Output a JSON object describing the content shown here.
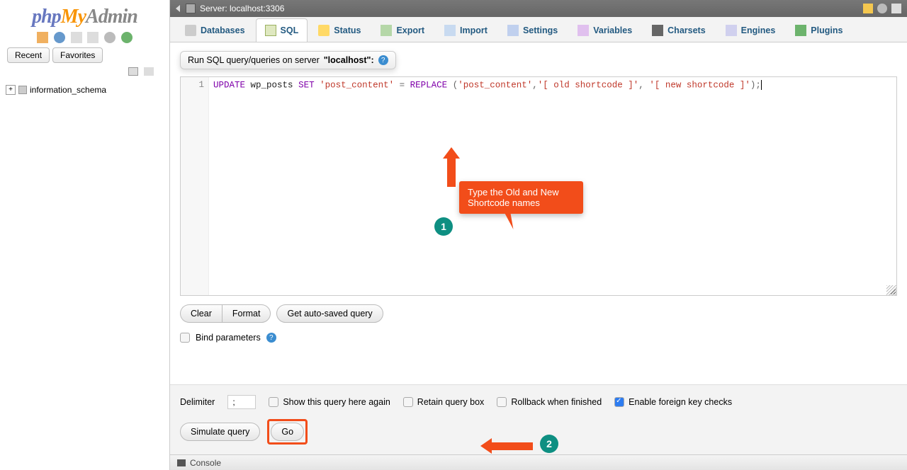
{
  "logo": {
    "p1": "php",
    "p2": "My",
    "p3": "Admin"
  },
  "sidebar": {
    "tabs": {
      "recent": "Recent",
      "favorites": "Favorites"
    },
    "tree": {
      "item1": "information_schema"
    }
  },
  "server_bar": {
    "label": "Server: localhost:3306"
  },
  "tabs": {
    "databases": "Databases",
    "sql": "SQL",
    "status": "Status",
    "export": "Export",
    "import": "Import",
    "settings": "Settings",
    "variables": "Variables",
    "charsets": "Charsets",
    "engines": "Engines",
    "plugins": "Plugins"
  },
  "query_header": {
    "prefix": "Run SQL query/queries on server ",
    "server": "\"localhost\":"
  },
  "editor": {
    "line_no": "1",
    "tokens": {
      "t1": "UPDATE",
      "sp1": " ",
      "t2": "wp_posts",
      "sp2": " ",
      "t3": "SET",
      "sp3": " ",
      "t4": "'post_content'",
      "sp4": " ",
      "t5": "=",
      "sp5": " ",
      "t6": "REPLACE",
      "sp6": " ",
      "t7": "(",
      "t8": "'post_content'",
      "t9": ",",
      "t10": "'[ old shortcode ]'",
      "t11": ",",
      "sp7": " ",
      "t12": "'[ new shortcode ]'",
      "t13": ")",
      "t14": ";"
    }
  },
  "buttons": {
    "clear": "Clear",
    "format": "Format",
    "autosaved": "Get auto-saved query",
    "simulate": "Simulate query",
    "go": "Go"
  },
  "options": {
    "bind_params": "Bind parameters",
    "delimiter_label": "Delimiter",
    "delimiter_value": ";",
    "show_again": "Show this query here again",
    "retain": "Retain query box",
    "rollback": "Rollback when finished",
    "fk_checks": "Enable foreign key checks"
  },
  "console": {
    "label": "Console"
  },
  "annotations": {
    "callout": "Type the Old and New Shortcode names",
    "badge1": "1",
    "badge2": "2"
  }
}
